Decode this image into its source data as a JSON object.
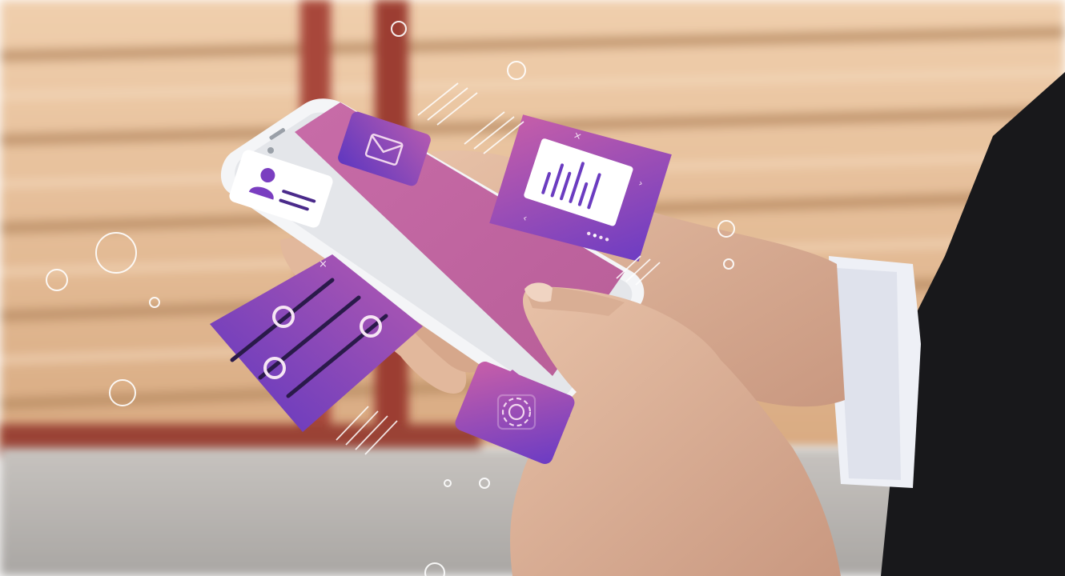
{
  "scene": {
    "subject": "hands-holding-smartphone",
    "floating_cards": [
      {
        "kind": "profile-card",
        "icon": "user-icon"
      },
      {
        "kind": "mail-card",
        "icon": "envelope-icon"
      },
      {
        "kind": "chart-card",
        "icon": "bar-chart-icon",
        "carousel_dots": 4
      },
      {
        "kind": "sliders-card",
        "icon": "sliders-icon",
        "slider_count": 3
      },
      {
        "kind": "settings-card",
        "icon": "gear-icon"
      }
    ]
  },
  "colors": {
    "wall_plank": "#e9c39e",
    "wall_groove": "#bd8f64",
    "red_post": "#a8463a",
    "pavement": "#b9b6b3",
    "phone_screen": "#c06aa0",
    "card_purple": "#7a3ec0",
    "card_pink": "#c25aa6",
    "skin": "#dcb39a",
    "suit": "#1a1a1d",
    "shirt_cuff": "#eef0f6"
  }
}
